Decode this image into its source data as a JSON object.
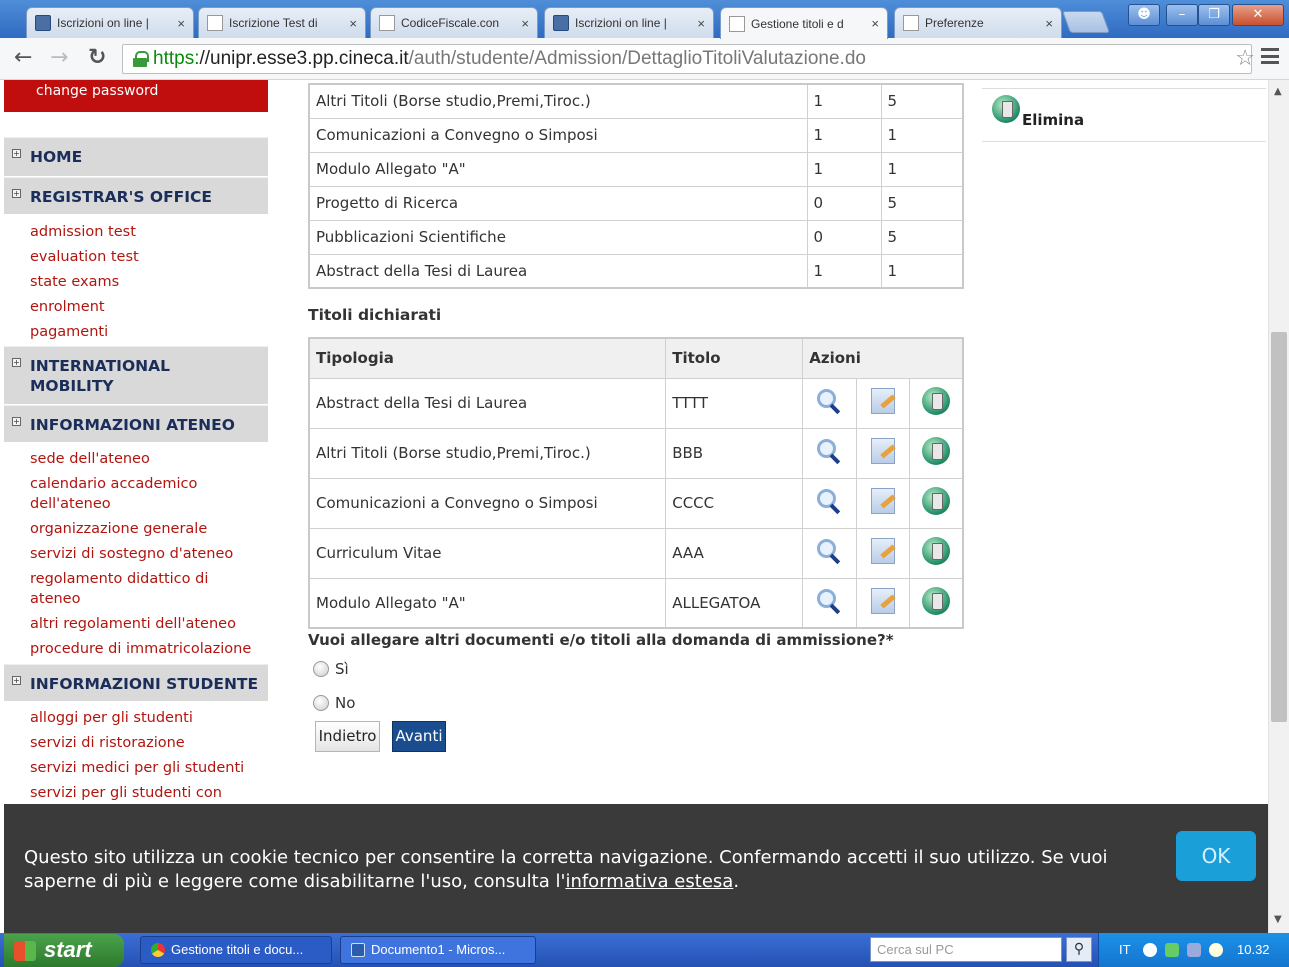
{
  "browser": {
    "tabs": [
      {
        "label": "Iscrizioni on line |",
        "icon": "cineca"
      },
      {
        "label": "Iscrizione Test di",
        "icon": "page"
      },
      {
        "label": "CodiceFiscale.con",
        "icon": "page"
      },
      {
        "label": "Iscrizioni on line |",
        "icon": "cineca"
      },
      {
        "label": "Gestione titoli e d",
        "icon": "page",
        "active": true
      },
      {
        "label": "Preferenze",
        "icon": "page"
      }
    ],
    "close_glyph": "×",
    "url_scheme": "https:",
    "url_host": "//unipr.esse3.pp.cineca.it",
    "url_path": "/auth/studente/Admission/DettaglioTitoliValutazione.do"
  },
  "sidebar": {
    "change_password": "change password",
    "sections": [
      {
        "title": "HOME",
        "links": []
      },
      {
        "title": "REGISTRAR'S OFFICE",
        "links": [
          "admission test",
          "evaluation test",
          "state exams",
          "enrolment",
          "pagamenti"
        ]
      },
      {
        "title": "INTERNATIONAL MOBILITY",
        "links": []
      },
      {
        "title": "INFORMAZIONI ATENEO",
        "links": [
          "sede dell'ateneo",
          "calendario accademico dell'ateneo",
          "organizzazione generale",
          "servizi di sostegno d'ateneo",
          "regolamento didattico di ateneo",
          "altri regolamenti dell'ateneo",
          "procedure di immatricolazione"
        ]
      },
      {
        "title": "INFORMAZIONI STUDENTE",
        "links": [
          "alloggi per gli studenti",
          "servizi di ristorazione",
          "servizi medici per gli studenti",
          "servizi per gli studenti con"
        ]
      }
    ]
  },
  "summary_table": {
    "rows": [
      [
        "Altri Titoli (Borse studio,Premi,Tiroc.)",
        "1",
        "5"
      ],
      [
        "Comunicazioni a Convegno o Simposi",
        "1",
        "1"
      ],
      [
        "Modulo Allegato \"A\"",
        "1",
        "1"
      ],
      [
        "Progetto di Ricerca",
        "0",
        "5"
      ],
      [
        "Pubblicazioni Scientifiche",
        "0",
        "5"
      ],
      [
        "Abstract della Tesi di Laurea",
        "1",
        "1"
      ]
    ]
  },
  "elimina_label": "Elimina",
  "declared": {
    "title": "Titoli dichiarati",
    "headers": {
      "tipologia": "Tipologia",
      "titolo": "Titolo",
      "azioni": "Azioni"
    },
    "rows": [
      {
        "tipologia": "Abstract della Tesi di Laurea",
        "titolo": "TTTT"
      },
      {
        "tipologia": "Altri Titoli (Borse studio,Premi,Tiroc.)",
        "titolo": "BBB"
      },
      {
        "tipologia": "Comunicazioni a Convegno o Simposi",
        "titolo": "CCCC"
      },
      {
        "tipologia": "Curriculum Vitae",
        "titolo": "AAA"
      },
      {
        "tipologia": "Modulo Allegato \"A\"",
        "titolo": "ALLEGATOA"
      }
    ]
  },
  "question": {
    "text": "Vuoi allegare altri documenti e/o titoli alla domanda di ammissione?*",
    "options": [
      "Sì",
      "No"
    ]
  },
  "buttons": {
    "back": "Indietro",
    "next": "Avanti"
  },
  "cookie": {
    "text": "Questo sito utilizza un cookie tecnico per consentire la corretta navigazione. Confermando accetti il suo utilizzo. Se vuoi saperne di più e leggere come disabilitarne l'uso, consulta l'",
    "link": "informativa estesa",
    "suffix": ".",
    "ok": "OK"
  },
  "taskbar": {
    "start": "start",
    "items": [
      "Gestione titoli e docu...",
      "Documento1 - Micros..."
    ],
    "search_placeholder": "Cerca sul PC",
    "lang": "IT",
    "clock": "10.32"
  },
  "colors": {
    "sidebar_link": "#b2150f",
    "sidebar_section_text": "#1b2d59",
    "change_password_bg": "#c00d0d",
    "next_button": "#1a4d8f",
    "ok_button": "#1a9fd8"
  }
}
